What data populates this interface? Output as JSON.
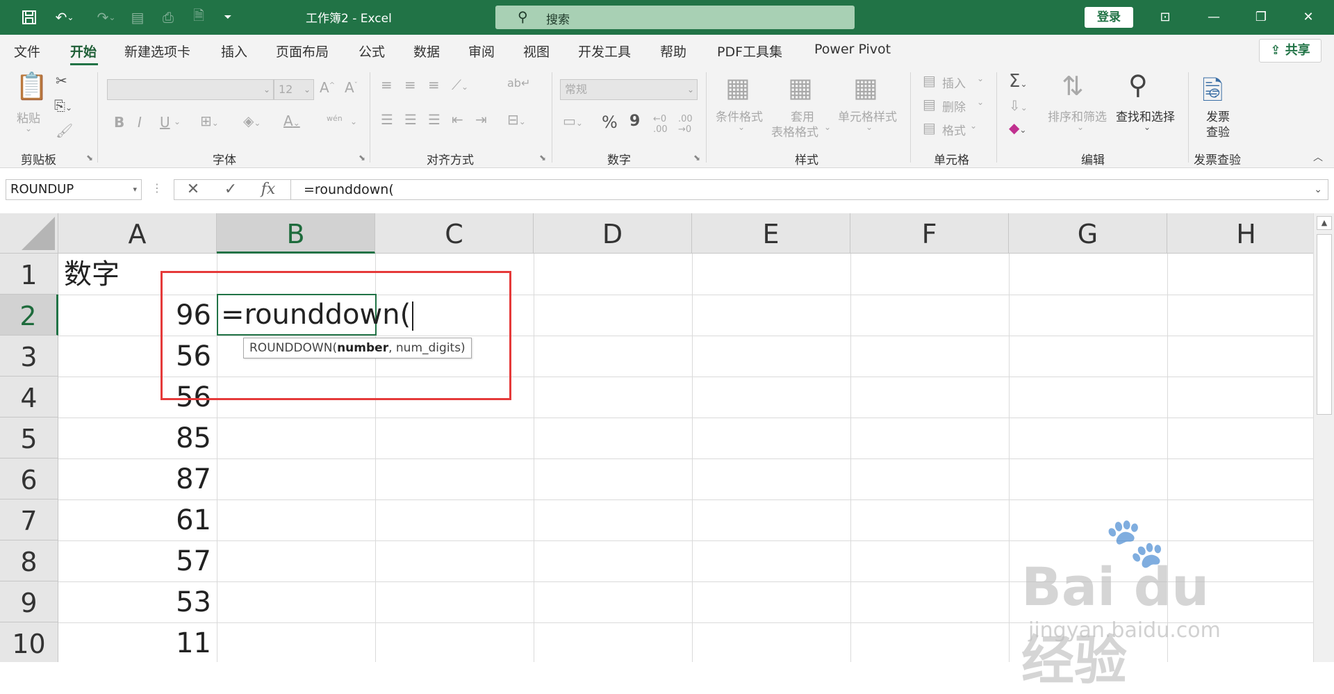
{
  "window": {
    "title": "工作簿2  -  Excel",
    "search_placeholder": "搜索",
    "login_label": "登录"
  },
  "menu": {
    "tabs": [
      "文件",
      "开始",
      "新建选项卡",
      "插入",
      "页面布局",
      "公式",
      "数据",
      "审阅",
      "视图",
      "开发工具",
      "帮助",
      "PDF工具集",
      "Power Pivot"
    ],
    "active_tab": "开始",
    "share_label": "共享"
  },
  "ribbon": {
    "clipboard": {
      "paste_label": "粘贴",
      "group_label": "剪贴板"
    },
    "font": {
      "font_size": "12",
      "bold": "B",
      "italic": "I",
      "underline": "U",
      "group_label": "字体",
      "phonetic": "wén"
    },
    "alignment": {
      "group_label": "对齐方式"
    },
    "number": {
      "format": "常规",
      "percent": "%",
      "comma": "9",
      "group_label": "数字"
    },
    "styles": {
      "conditional_format": "条件格式",
      "table_format_1": "套用",
      "table_format_2": "表格格式",
      "cell_styles": "单元格样式",
      "group_label": "样式"
    },
    "cells": {
      "insert": "插入",
      "delete": "删除",
      "format": "格式",
      "group_label": "单元格"
    },
    "editing": {
      "sort_filter": "排序和筛选",
      "find_select": "查找和选择",
      "group_label": "编辑"
    },
    "invoice": {
      "label_1": "发票",
      "label_2": "查验",
      "group_label": "发票查验"
    }
  },
  "formula_bar": {
    "name_box": "ROUNDUP",
    "cancel": "✕",
    "enter": "✓",
    "fx": "fx",
    "content": "=rounddown("
  },
  "sheet": {
    "columns": [
      "A",
      "B",
      "C",
      "D",
      "E",
      "F",
      "G",
      "H"
    ],
    "selected_column": "B",
    "rows": [
      "1",
      "2",
      "3",
      "4",
      "5",
      "6",
      "7",
      "8",
      "9",
      "10"
    ],
    "selected_row": "2",
    "a1": "数字",
    "column_a_values": [
      "96",
      "56",
      "56",
      "85",
      "87",
      "61",
      "57",
      "53",
      "11"
    ],
    "editing_cell_text": "=rounddown(",
    "tooltip": {
      "func": "ROUNDDOWN(",
      "arg1": "number",
      "rest": ", num_digits)"
    }
  },
  "watermark": {
    "text": "Bai du 经验",
    "url": "jingyan.baidu.com"
  },
  "colors": {
    "excel_green": "#217346",
    "highlight_red": "#e53a3a"
  }
}
